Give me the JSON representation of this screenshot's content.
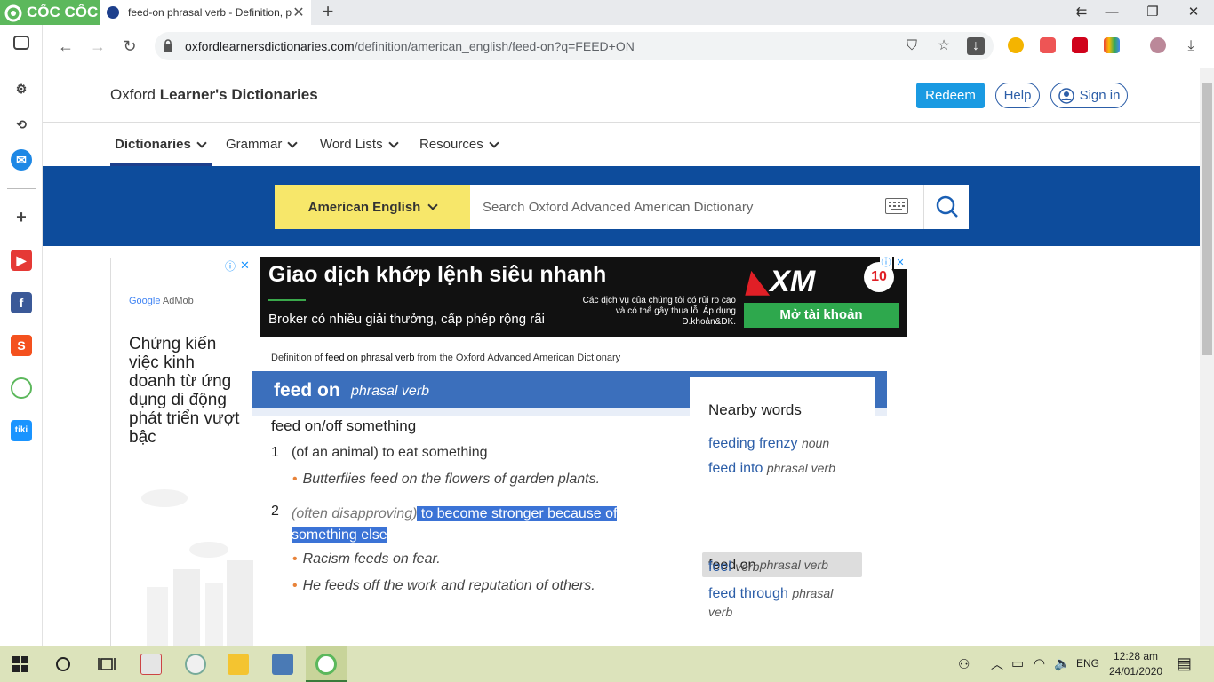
{
  "browser": {
    "brand": "CỐC CỐC",
    "tab_title": "feed-on phrasal verb - Definition, p",
    "url_host": "oxfordlearnersdictionaries.com",
    "url_path": "/definition/american_english/feed-on?q=FEED+ON"
  },
  "site": {
    "brand_prefix": "Oxford ",
    "brand_bold": "Learner's Dictionaries",
    "redeem": "Redeem",
    "help": "Help",
    "signin": "Sign in",
    "menu": [
      "Dictionaries",
      "Grammar",
      "Word Lists",
      "Resources"
    ],
    "search": {
      "dictionary": "American English",
      "placeholder": "Search Oxford Advanced American Dictionary"
    }
  },
  "left_ad": {
    "brand_google": "Google",
    "brand_admob": " AdMob",
    "text": "Chứng kiến việc kinh doanh từ ứng dụng di động phát triển vượt bậc"
  },
  "top_ad": {
    "headline": "Giao dịch khớp lệnh siêu nhanh",
    "sub": "Broker có nhiều giải thưởng, cấp phép rộng rãi",
    "fine_print": "Các dịch vụ của chúng tôi có rủi ro cao và có thể gây thua lỗ. Áp dụng Đ.khoản&ĐK.",
    "brand": "XM",
    "cta": "Mở tài khoản"
  },
  "entry": {
    "source_prefix": "Definition of ",
    "source_word": "feed on phrasal verb",
    "source_suffix": " from the Oxford Advanced American Dictionary",
    "headword": "feed on",
    "pos": "phrasal verb",
    "idiom": "feed on/off something",
    "senses": [
      {
        "num": "1",
        "def": "(of an animal) to eat something",
        "examples": [
          "Butterflies feed on the flowers of garden plants."
        ]
      },
      {
        "num": "2",
        "label": "(often disapproving)",
        "def_line1": " to become stronger because of ",
        "def_line2": "something else",
        "examples": [
          "Racism feeds on fear.",
          "He feeds off the work and reputation of others."
        ]
      }
    ]
  },
  "nearby": {
    "title": "Nearby words",
    "items": [
      {
        "word": "feeding frenzy",
        "pos": "noun"
      },
      {
        "word": "feed into",
        "pos": "phrasal verb"
      },
      {
        "word": "feed on",
        "pos": "phrasal verb"
      },
      {
        "word": "feed through",
        "pos": "phrasal verb"
      },
      {
        "word": "feel",
        "pos": "verb"
      }
    ]
  },
  "taskbar": {
    "lang": "ENG",
    "time": "12:28 am",
    "date": "24/01/2020"
  }
}
